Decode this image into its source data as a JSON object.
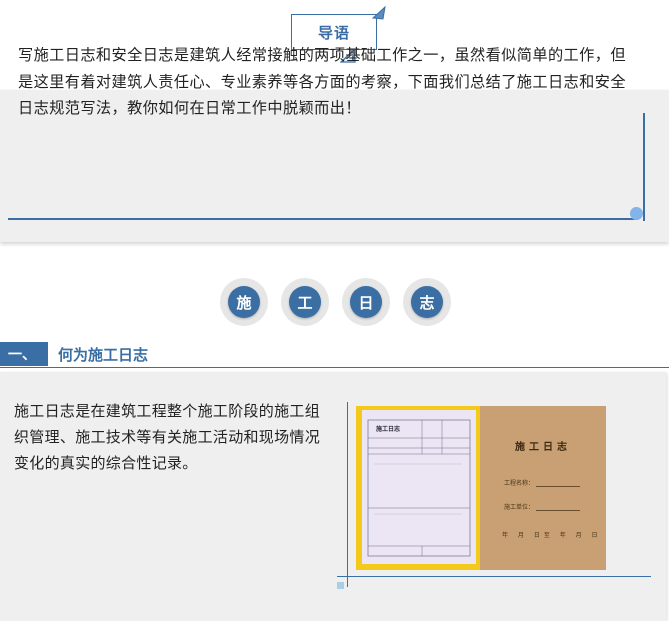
{
  "header": {
    "label": "导语"
  },
  "intro": {
    "text": "写施工日志和安全日志是建筑人经常接触的两项基础工作之一，虽然看似简单的工作，但是这里有着对建筑人责任心、专业素养等各方面的考察，下面我们总结了施工日志和安全日志规范写法，教你如何在日常工作中脱颖而出！"
  },
  "title_circles": [
    "施",
    "工",
    "日",
    "志"
  ],
  "section": {
    "number": "一、",
    "title": "何为施工日志",
    "body": "施工日志是在建筑工程整个施工阶段的施工组织管理、施工技术等有关施工活动和现场情况变化的真实的综合性记录。"
  },
  "photo": {
    "sheet_heading": "施工日志",
    "cover_title": "施工日志",
    "cover_field_1": "工程名称：",
    "cover_field_2": "施工单位：",
    "cover_date": "年 月 日至 年 月 日"
  },
  "colors": {
    "accent": "#3a6fa5",
    "panel_bg": "#efefef",
    "dot": "#82b4ea",
    "photo_yellow": "#f3c91c",
    "cover_brown": "#c8a073"
  }
}
